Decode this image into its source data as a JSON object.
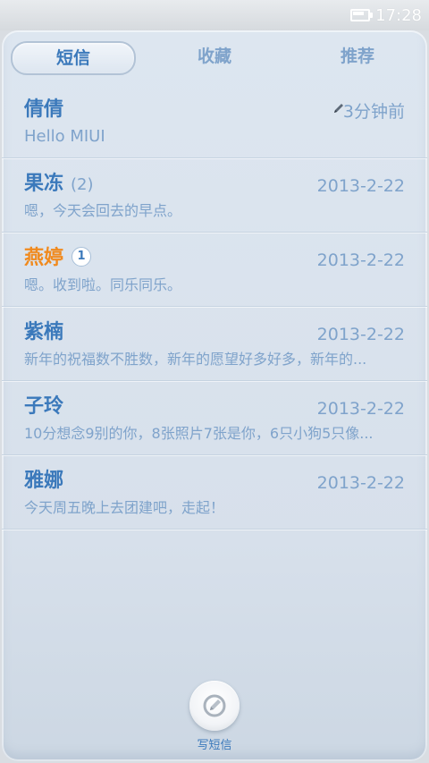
{
  "status_bar": {
    "time": "17:28"
  },
  "tabs": [
    {
      "label": "短信"
    },
    {
      "label": "收藏"
    },
    {
      "label": "推荐"
    }
  ],
  "threads": [
    {
      "name": "倩倩",
      "time": "3分钟前",
      "preview": "Hello MIUI",
      "draft": true
    },
    {
      "name": "果冻",
      "count": "(2)",
      "time": "2013-2-22",
      "preview": "嗯，今天会回去的早点。"
    },
    {
      "name": "燕婷",
      "unread": "1",
      "time": "2013-2-22",
      "preview": "嗯。收到啦。同乐同乐。"
    },
    {
      "name": "紫楠",
      "time": "2013-2-22",
      "preview": "新年的祝福数不胜数，新年的愿望好多好多，新年的..."
    },
    {
      "name": "子玲",
      "time": "2013-2-22",
      "preview": "10分想念9别的你，8张照片7张是你，6只小狗5只像..."
    },
    {
      "name": "雅娜",
      "time": "2013-2-22",
      "preview": "今天周五晚上去团建吧，走起！"
    }
  ],
  "compose": {
    "label": "写短信"
  },
  "colors": {
    "accent": "#3b79bb",
    "secondary": "#7fa3cb",
    "unread_name": "#f08a1e"
  }
}
